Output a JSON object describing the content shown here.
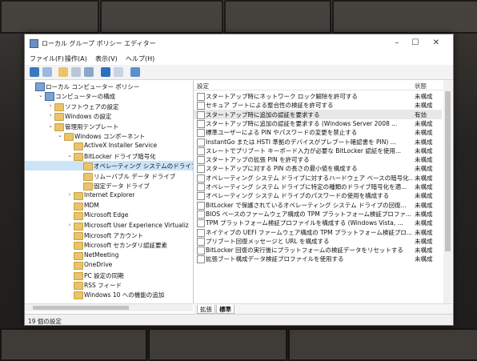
{
  "window": {
    "title": "ローカル グループ ポリシー エディター"
  },
  "menu": [
    "ファイル(F)",
    "操作(A)",
    "表示(V)",
    "ヘルプ(H)"
  ],
  "tree": [
    {
      "label": "ローカル コンピューター ポリシー",
      "level": 0,
      "expander": "",
      "kind": "pc"
    },
    {
      "label": "コンピューターの構成",
      "level": 1,
      "expander": "⌄",
      "kind": "pc"
    },
    {
      "label": "ソフトウェアの設定",
      "level": 2,
      "expander": "›",
      "kind": "folder"
    },
    {
      "label": "Windows の設定",
      "level": 2,
      "expander": "›",
      "kind": "folder"
    },
    {
      "label": "管理用テンプレート",
      "level": 2,
      "expander": "⌄",
      "kind": "folder"
    },
    {
      "label": "Windows コンポーネント",
      "level": 3,
      "expander": "⌄",
      "kind": "folder"
    },
    {
      "label": "ActiveX Installer Service",
      "level": 4,
      "expander": "",
      "kind": "folder"
    },
    {
      "label": "BitLocker ドライブ暗号化",
      "level": 4,
      "expander": "⌄",
      "kind": "folder"
    },
    {
      "label": "オペレーティング システムのドライブ",
      "level": 5,
      "expander": "",
      "kind": "folder",
      "selected": true
    },
    {
      "label": "リムーバブル データ ドライブ",
      "level": 5,
      "expander": "",
      "kind": "folder"
    },
    {
      "label": "固定データ ドライブ",
      "level": 5,
      "expander": "",
      "kind": "folder"
    },
    {
      "label": "Internet Explorer",
      "level": 4,
      "expander": "›",
      "kind": "folder"
    },
    {
      "label": "MDM",
      "level": 4,
      "expander": "",
      "kind": "folder"
    },
    {
      "label": "Microsoft Edge",
      "level": 4,
      "expander": "",
      "kind": "folder"
    },
    {
      "label": "Microsoft User Experience Virtualiz",
      "level": 4,
      "expander": "›",
      "kind": "folder"
    },
    {
      "label": "Microsoft アカウント",
      "level": 4,
      "expander": "",
      "kind": "folder"
    },
    {
      "label": "Microsoft セカンダリ認証要素",
      "level": 4,
      "expander": "",
      "kind": "folder"
    },
    {
      "label": "NetMeeting",
      "level": 4,
      "expander": "",
      "kind": "folder"
    },
    {
      "label": "OneDrive",
      "level": 4,
      "expander": "",
      "kind": "folder"
    },
    {
      "label": "PC 設定の同期",
      "level": 4,
      "expander": "",
      "kind": "folder"
    },
    {
      "label": "RSS フィード",
      "level": 4,
      "expander": "",
      "kind": "folder"
    },
    {
      "label": "Windows 10 への機能の追加",
      "level": 4,
      "expander": "",
      "kind": "folder"
    }
  ],
  "columns": {
    "setting": "設定",
    "state": "状態"
  },
  "policies": [
    {
      "name": "スタートアップ時にネットワーク ロック解除を許可する",
      "state": "未構成"
    },
    {
      "name": "セキュア ブートによる整合性の検証を許可する",
      "state": "未構成"
    },
    {
      "name": "スタートアップ時に追加の認証を要求する",
      "state": "有効",
      "highlight": true
    },
    {
      "name": "スタートアップ時に追加の認証を要求する (Windows Server 2008 ...",
      "state": "未構成"
    },
    {
      "name": "標準ユーザーによる PIN やパスワードの変更を禁止する",
      "state": "未構成"
    },
    {
      "name": "InstantGo または HSTI 準拠のデバイスがプレブート確認書を PIN) ...",
      "state": "未構成"
    },
    {
      "name": "スレートでプリブート キーボード入力が必要な BitLocker 認証を使用...",
      "state": "未構成"
    },
    {
      "name": "スタートアップの拡張 PIN を許可する",
      "state": "未構成"
    },
    {
      "name": "スタートアップに対する PIN の長さの最小値を構成する",
      "state": "未構成"
    },
    {
      "name": "オペレーティング システム ドライブに対するハードウェア ベースの暗号化...",
      "state": "未構成"
    },
    {
      "name": "オペレーティング システム ドライブに特定の種類のドライブ暗号化を適...",
      "state": "未構成"
    },
    {
      "name": "オペレーティング システム ドライブのパスワードの使用を構成する",
      "state": "未構成"
    },
    {
      "name": "BitLocker で保護されているオペレーティング システム ドライブの回復...",
      "state": "未構成"
    },
    {
      "name": "BIOS ベースのファームウェア構成の TPM プラットフォーム検証プロファ...",
      "state": "未構成"
    },
    {
      "name": "TPM プラットフォーム検証プロファイルを構成する (Windows Vista, ...",
      "state": "未構成"
    },
    {
      "name": "ネイティブの UEFI ファームウェア構成の TPM プラットフォーム検証プロ...",
      "state": "未構成"
    },
    {
      "name": "プリブート回復メッセージと URL を構成する",
      "state": "未構成"
    },
    {
      "name": "BitLocker 回復の実行後にプラットフォームの検証データをリセットする",
      "state": "未構成"
    },
    {
      "name": "拡張ブート構成データ検証プロファイルを使用する",
      "state": "未構成"
    }
  ],
  "tabs": [
    "拡張",
    "標準"
  ],
  "status": "19 個の設定"
}
